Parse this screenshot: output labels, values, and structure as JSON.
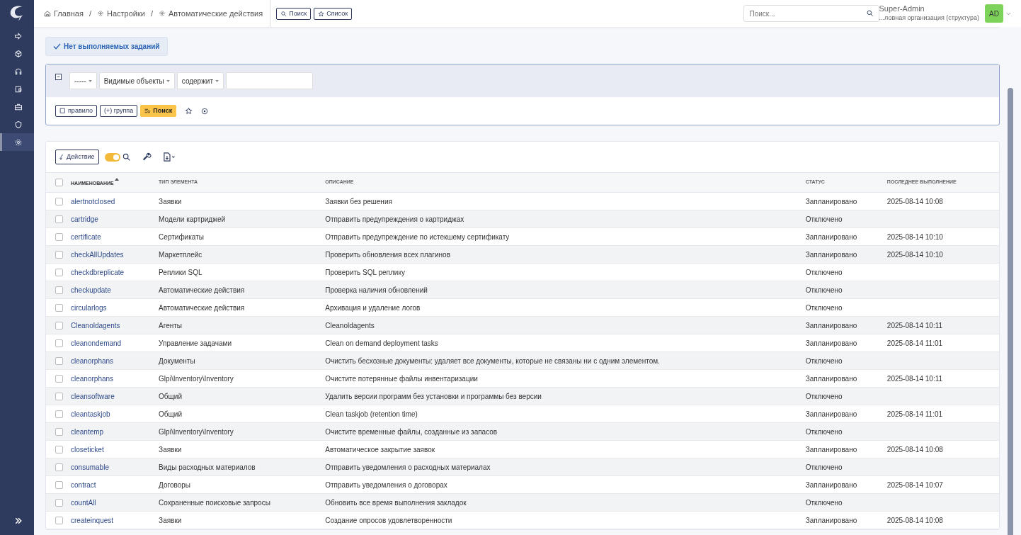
{
  "sidebar": {
    "items": [
      {
        "selected": false
      },
      {
        "selected": false
      },
      {
        "selected": false
      },
      {
        "selected": false
      },
      {
        "selected": false
      },
      {
        "selected": false
      },
      {
        "selected": true
      }
    ]
  },
  "breadcrumb": [
    {
      "label": "Главная"
    },
    {
      "separator": "/",
      "label": "Настройки"
    },
    {
      "separator": "/",
      "label": "Автоматические действия"
    }
  ],
  "header_buttons": [
    "Поиск",
    "Список"
  ],
  "global_search": {
    "placeholder": "Поиск..."
  },
  "user": {
    "name": "Super-Admin",
    "entity": "...ловная организация (структура)",
    "initials": "AD"
  },
  "status_button": "Нет выполняемых заданий",
  "criteria": {
    "field": "-----",
    "scope": "Видимые объекты",
    "operator": "содержит"
  },
  "criteria_buttons": [
    "правило",
    "(+) группа",
    "Поиск"
  ],
  "toolbar": {
    "action": "Действие",
    "toggle_on": true
  },
  "table": {
    "all_checked": false,
    "columns": [
      {
        "label": "НАИМЕНОВАНИЕ",
        "sorted": true
      },
      {
        "label": "ТИП ЭЛЕМЕНТА",
        "sorted": false
      },
      {
        "label": "ОПИСАНИЕ",
        "sorted": false
      },
      {
        "label": "СТАТУС",
        "sorted": false
      },
      {
        "label": "ПОСЛЕДНЕЕ ВЫПОЛНЕНИЕ",
        "sorted": false
      }
    ],
    "rows": [
      {
        "checked": false,
        "cells": [
          "alertnotclosed",
          "Заявки",
          "Заявки без решения",
          "Запланировано",
          "2025-08-14 10:08"
        ]
      },
      {
        "checked": false,
        "cells": [
          "cartridge",
          "Модели картриджей",
          "Отправить предупреждения о картриджах",
          "Отключено",
          ""
        ]
      },
      {
        "checked": false,
        "cells": [
          "certificate",
          "Сертификаты",
          "Отправить предупреждение по истекшему сертификату",
          "Запланировано",
          "2025-08-14 10:10"
        ]
      },
      {
        "checked": false,
        "cells": [
          "checkAllUpdates",
          "Маркетплейс",
          "Проверить обновления всех плагинов",
          "Запланировано",
          "2025-08-14 10:10"
        ]
      },
      {
        "checked": false,
        "cells": [
          "checkdbreplicate",
          "Реплики SQL",
          "Проверить SQL реплику",
          "Отключено",
          ""
        ]
      },
      {
        "checked": false,
        "cells": [
          "checkupdate",
          "Автоматические действия",
          "Проверка наличия обновлений",
          "Отключено",
          ""
        ]
      },
      {
        "checked": false,
        "cells": [
          "circularlogs",
          "Автоматические действия",
          "Архивация и удаление логов",
          "Отключено",
          ""
        ]
      },
      {
        "checked": false,
        "cells": [
          "Cleanoldagents",
          "Агенты",
          "Cleanoldagents",
          "Запланировано",
          "2025-08-14 10:11"
        ]
      },
      {
        "checked": false,
        "cells": [
          "cleanondemand",
          "Управление задачами",
          "Clean on demand deployment tasks",
          "Запланировано",
          "2025-08-14 11:01"
        ]
      },
      {
        "checked": false,
        "cells": [
          "cleanorphans",
          "Документы",
          "Очистить бесхозные документы: удаляет все документы, которые не связаны ни с одним элементом.",
          "Отключено",
          ""
        ]
      },
      {
        "checked": false,
        "cells": [
          "cleanorphans",
          "Glpi\\Inventory\\Inventory",
          "Очистите потерянные файлы инвентаризации",
          "Запланировано",
          "2025-08-14 10:11"
        ]
      },
      {
        "checked": false,
        "cells": [
          "cleansoftware",
          "Общий",
          "Удалить версии программ без установки и программы без версии",
          "Отключено",
          ""
        ]
      },
      {
        "checked": false,
        "cells": [
          "cleantaskjob",
          "Общий",
          "Clean taskjob (retention time)",
          "Запланировано",
          "2025-08-14 11:01"
        ]
      },
      {
        "checked": false,
        "cells": [
          "cleantemp",
          "Glpi\\Inventory\\Inventory",
          "Очистите временные файлы, созданные из запасов",
          "Отключено",
          ""
        ]
      },
      {
        "checked": false,
        "cells": [
          "closeticket",
          "Заявки",
          "Автоматическое закрытие заявок",
          "Запланировано",
          "2025-08-14 10:08"
        ]
      },
      {
        "checked": false,
        "cells": [
          "consumable",
          "Виды расходных материалов",
          "Отправить уведомления о расходных материалах",
          "Отключено",
          ""
        ]
      },
      {
        "checked": false,
        "cells": [
          "contract",
          "Договоры",
          "Отправить уведомления о договорах",
          "Запланировано",
          "2025-08-14 10:07"
        ]
      },
      {
        "checked": false,
        "cells": [
          "countAll",
          "Сохраненные поисковые запросы",
          "Обновить все время выполнения закладок",
          "Отключено",
          ""
        ]
      },
      {
        "checked": false,
        "cells": [
          "createinquest",
          "Заявки",
          "Создание опросов удовлетворенности",
          "Запланировано",
          "2025-08-14 10:08"
        ]
      }
    ]
  }
}
